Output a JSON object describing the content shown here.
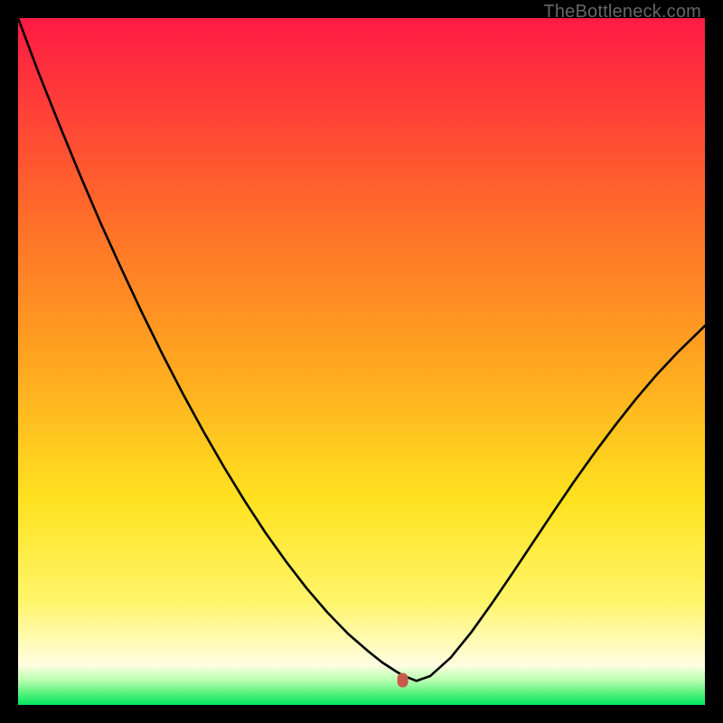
{
  "watermark": "TheBottleneck.com",
  "chart_data": {
    "type": "line",
    "title": "",
    "xlabel": "",
    "ylabel": "",
    "xlim": [
      0,
      100
    ],
    "ylim": [
      0,
      100
    ],
    "grid": false,
    "series": [
      {
        "name": "bottleneck-curve",
        "x": [
          0,
          3,
          6,
          9,
          12,
          15,
          18,
          21,
          24,
          27,
          30,
          33,
          36,
          39,
          42,
          45,
          48,
          51,
          53,
          55,
          56,
          58,
          60,
          63,
          66,
          69,
          72,
          75,
          78,
          81,
          84,
          87,
          90,
          93,
          96,
          100
        ],
        "values": [
          100,
          92,
          84.5,
          77.2,
          70.2,
          63.6,
          57.2,
          51.1,
          45.3,
          39.8,
          34.6,
          29.7,
          25.1,
          20.9,
          17.0,
          13.5,
          10.4,
          7.8,
          6.2,
          4.9,
          4.3,
          3.5,
          4.2,
          6.9,
          10.6,
          14.8,
          19.2,
          23.7,
          28.2,
          32.6,
          36.8,
          40.8,
          44.6,
          48.1,
          51.3,
          55.2
        ]
      }
    ],
    "green_band": {
      "y0": 0,
      "y1": 5.5
    },
    "marker": {
      "x": 56,
      "y": 3.6,
      "label": "optimal-point"
    }
  },
  "colors": {
    "gradient_top": "#ff1a44",
    "gradient_mid1": "#ff7a1f",
    "gradient_mid2": "#ffd21f",
    "gradient_mid3": "#fff56a",
    "gradient_bottom": "#fffde0",
    "green_pale": "#d8ffca",
    "green_mid": "#6ff77c",
    "green_deep": "#00e860",
    "curve": "#000000",
    "marker": "#c85a4a"
  }
}
